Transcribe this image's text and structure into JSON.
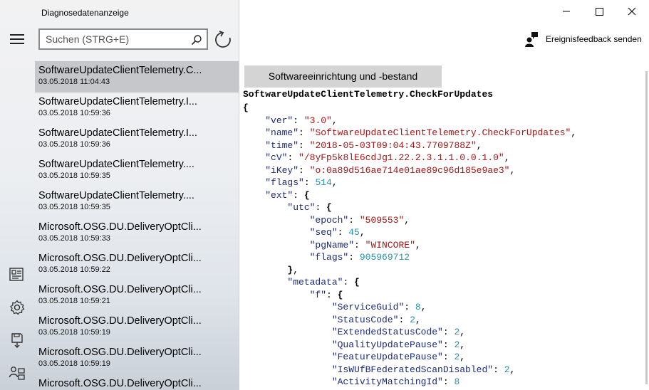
{
  "app": {
    "title": "Diagnosedatenanzeige"
  },
  "search": {
    "placeholder": "Suchen (STRG+E)"
  },
  "events": [
    {
      "name": "SoftwareUpdateClientTelemetry.C...",
      "time": "03.05.2018 11:04:43",
      "selected": true
    },
    {
      "name": "SoftwareUpdateClientTelemetry.I...",
      "time": "03.05.2018 10:59:36"
    },
    {
      "name": "SoftwareUpdateClientTelemetry.I...",
      "time": "03.05.2018 10:59:36"
    },
    {
      "name": "SoftwareUpdateClientTelemetry....",
      "time": "03.05.2018 10:59:35"
    },
    {
      "name": "SoftwareUpdateClientTelemetry....",
      "time": "03.05.2018 10:59:35"
    },
    {
      "name": "Microsoft.OSG.DU.DeliveryOptCli...",
      "time": "03.05.2018 10:59:33"
    },
    {
      "name": "Microsoft.OSG.DU.DeliveryOptCli...",
      "time": "03.05.2018 10:59:22"
    },
    {
      "name": "Microsoft.OSG.DU.DeliveryOptCli...",
      "time": "03.05.2018 10:59:21"
    },
    {
      "name": "Microsoft.OSG.DU.DeliveryOptCli...",
      "time": "03.05.2018 10:59:19"
    },
    {
      "name": "Microsoft.OSG.DU.DeliveryOptCli...",
      "time": "03.05.2018 10:59:19"
    },
    {
      "name": "Microsoft.OSG.DU.DeliveryOptCli...",
      "time": ""
    }
  ],
  "header": {
    "feedback_label": "Ereignisfeedback senden"
  },
  "detail": {
    "category": "Softwareeinrichtung und -bestand",
    "event_title": "SoftwareUpdateClientTelemetry.CheckForUpdates",
    "json_lines": [
      {
        "indent": 0,
        "parts": [
          {
            "t": "brace",
            "v": "{"
          }
        ]
      },
      {
        "indent": 1,
        "parts": [
          {
            "t": "key",
            "v": "\"ver\""
          },
          {
            "t": "p",
            "v": ": "
          },
          {
            "t": "str",
            "v": "\"3.0\""
          },
          {
            "t": "p",
            "v": ","
          }
        ]
      },
      {
        "indent": 1,
        "parts": [
          {
            "t": "key",
            "v": "\"name\""
          },
          {
            "t": "p",
            "v": ": "
          },
          {
            "t": "str",
            "v": "\"SoftwareUpdateClientTelemetry.CheckForUpdates\""
          },
          {
            "t": "p",
            "v": ","
          }
        ]
      },
      {
        "indent": 1,
        "parts": [
          {
            "t": "key",
            "v": "\"time\""
          },
          {
            "t": "p",
            "v": ": "
          },
          {
            "t": "str",
            "v": "\"2018-05-03T09:04:43.7709788Z\""
          },
          {
            "t": "p",
            "v": ","
          }
        ]
      },
      {
        "indent": 1,
        "parts": [
          {
            "t": "key",
            "v": "\"cV\""
          },
          {
            "t": "p",
            "v": ": "
          },
          {
            "t": "str",
            "v": "\"/8yFp5k8lE6cdJg1.22.2.3.1.1.0.0.1.0\""
          },
          {
            "t": "p",
            "v": ","
          }
        ]
      },
      {
        "indent": 1,
        "parts": [
          {
            "t": "key",
            "v": "\"iKey\""
          },
          {
            "t": "p",
            "v": ": "
          },
          {
            "t": "str",
            "v": "\"o:0a89d516ae714e01ae89c96d185e9ae3\""
          },
          {
            "t": "p",
            "v": ","
          }
        ]
      },
      {
        "indent": 1,
        "parts": [
          {
            "t": "key",
            "v": "\"flags\""
          },
          {
            "t": "p",
            "v": ": "
          },
          {
            "t": "num",
            "v": "514"
          },
          {
            "t": "p",
            "v": ","
          }
        ]
      },
      {
        "indent": 1,
        "parts": [
          {
            "t": "key",
            "v": "\"ext\""
          },
          {
            "t": "p",
            "v": ": "
          },
          {
            "t": "brace",
            "v": "{"
          }
        ]
      },
      {
        "indent": 2,
        "parts": [
          {
            "t": "key",
            "v": "\"utc\""
          },
          {
            "t": "p",
            "v": ": "
          },
          {
            "t": "brace",
            "v": "{"
          }
        ]
      },
      {
        "indent": 3,
        "parts": [
          {
            "t": "key",
            "v": "\"epoch\""
          },
          {
            "t": "p",
            "v": ": "
          },
          {
            "t": "str",
            "v": "\"509553\""
          },
          {
            "t": "p",
            "v": ","
          }
        ]
      },
      {
        "indent": 3,
        "parts": [
          {
            "t": "key",
            "v": "\"seq\""
          },
          {
            "t": "p",
            "v": ": "
          },
          {
            "t": "num",
            "v": "45"
          },
          {
            "t": "p",
            "v": ","
          }
        ]
      },
      {
        "indent": 3,
        "parts": [
          {
            "t": "key",
            "v": "\"pgName\""
          },
          {
            "t": "p",
            "v": ": "
          },
          {
            "t": "str",
            "v": "\"WINCORE\""
          },
          {
            "t": "p",
            "v": ","
          }
        ]
      },
      {
        "indent": 3,
        "parts": [
          {
            "t": "key",
            "v": "\"flags\""
          },
          {
            "t": "p",
            "v": ": "
          },
          {
            "t": "num",
            "v": "905969712"
          }
        ]
      },
      {
        "indent": 2,
        "parts": [
          {
            "t": "brace",
            "v": "}"
          },
          {
            "t": "p",
            "v": ","
          }
        ]
      },
      {
        "indent": 2,
        "parts": [
          {
            "t": "key",
            "v": "\"metadata\""
          },
          {
            "t": "p",
            "v": ": "
          },
          {
            "t": "brace",
            "v": "{"
          }
        ]
      },
      {
        "indent": 3,
        "parts": [
          {
            "t": "key",
            "v": "\"f\""
          },
          {
            "t": "p",
            "v": ": "
          },
          {
            "t": "brace",
            "v": "{"
          }
        ]
      },
      {
        "indent": 4,
        "parts": [
          {
            "t": "key",
            "v": "\"ServiceGuid\""
          },
          {
            "t": "p",
            "v": ": "
          },
          {
            "t": "num",
            "v": "8"
          },
          {
            "t": "p",
            "v": ","
          }
        ]
      },
      {
        "indent": 4,
        "parts": [
          {
            "t": "key",
            "v": "\"StatusCode\""
          },
          {
            "t": "p",
            "v": ": "
          },
          {
            "t": "num",
            "v": "2"
          },
          {
            "t": "p",
            "v": ","
          }
        ]
      },
      {
        "indent": 4,
        "parts": [
          {
            "t": "key",
            "v": "\"ExtendedStatusCode\""
          },
          {
            "t": "p",
            "v": ": "
          },
          {
            "t": "num",
            "v": "2"
          },
          {
            "t": "p",
            "v": ","
          }
        ]
      },
      {
        "indent": 4,
        "parts": [
          {
            "t": "key",
            "v": "\"QualityUpdatePause\""
          },
          {
            "t": "p",
            "v": ": "
          },
          {
            "t": "num",
            "v": "2"
          },
          {
            "t": "p",
            "v": ","
          }
        ]
      },
      {
        "indent": 4,
        "parts": [
          {
            "t": "key",
            "v": "\"FeatureUpdatePause\""
          },
          {
            "t": "p",
            "v": ": "
          },
          {
            "t": "num",
            "v": "2"
          },
          {
            "t": "p",
            "v": ","
          }
        ]
      },
      {
        "indent": 4,
        "parts": [
          {
            "t": "key",
            "v": "\"IsWUfBFederatedScanDisabled\""
          },
          {
            "t": "p",
            "v": ": "
          },
          {
            "t": "num",
            "v": "2"
          },
          {
            "t": "p",
            "v": ","
          }
        ]
      },
      {
        "indent": 4,
        "parts": [
          {
            "t": "key",
            "v": "\"ActivityMatchingId\""
          },
          {
            "t": "p",
            "v": ": "
          },
          {
            "t": "num",
            "v": "8"
          }
        ]
      }
    ]
  },
  "icons": {
    "menu": "hamburger-icon",
    "search": "search-icon",
    "refresh": "refresh-icon",
    "nav_1": "diagnostic-data-icon",
    "nav_2": "settings-icon",
    "nav_3": "export-data-icon",
    "nav_4": "user-account-icon",
    "feedback": "feedback-icon",
    "minimize": "minimize-icon",
    "maximize": "maximize-icon",
    "close": "close-icon"
  },
  "colors": {
    "selected_row": "#c5c7cb",
    "category_bg": "#d4d4d4",
    "json_key": "#1b2a7a",
    "json_string": "#a31515",
    "json_number": "#2b91af"
  }
}
